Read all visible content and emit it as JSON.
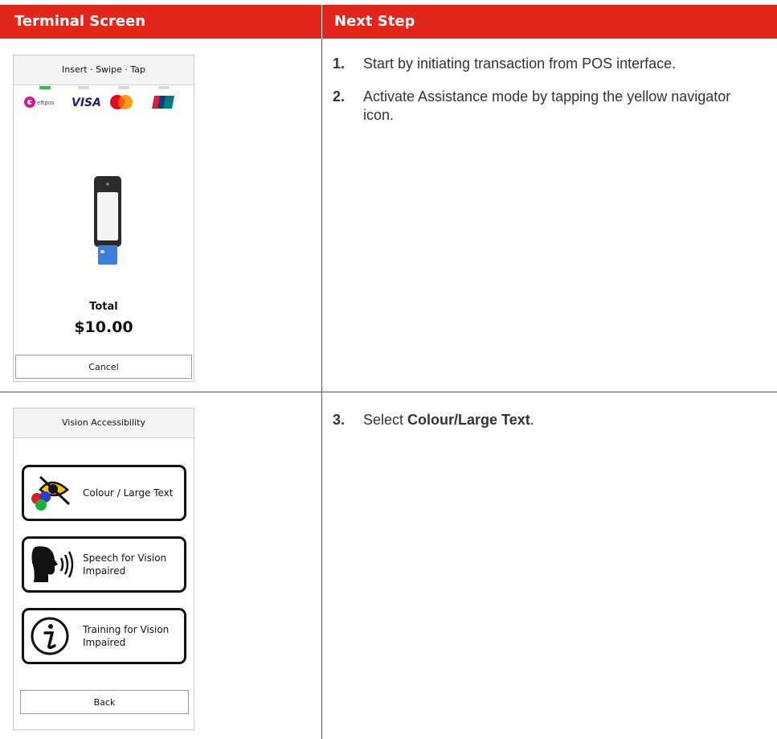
{
  "table": {
    "header_left": "Terminal Screen",
    "header_right": "Next Step"
  },
  "row1": {
    "screen": {
      "title": "Insert · Swipe · Tap",
      "brands": [
        "eftpos",
        "VISA",
        "Mastercard",
        "UnionPay"
      ],
      "total_label": "Total",
      "total_amount": "$10.00",
      "cancel_label": "Cancel"
    },
    "steps": [
      {
        "num": "1.",
        "text": "Start by initiating transaction from POS interface."
      },
      {
        "num": "2.",
        "text": "Activate Assistance mode by tapping the yellow navigator icon."
      }
    ]
  },
  "row2": {
    "screen": {
      "title": "Vision Accessibility",
      "options": [
        {
          "label": "Colour / Large Text",
          "icon": "colour-eye-icon"
        },
        {
          "label": "Speech for Vision Impaired",
          "icon": "speaking-head-icon"
        },
        {
          "label": "Training for Vision Impaired",
          "icon": "info-icon"
        }
      ],
      "back_label": "Back"
    },
    "steps": [
      {
        "num": "3.",
        "prefix": "Select ",
        "bold": "Colour/Large Text",
        "suffix": "."
      }
    ]
  },
  "colors": {
    "header_bg": "#e3261c",
    "indicator_active": "#2bc24a"
  }
}
